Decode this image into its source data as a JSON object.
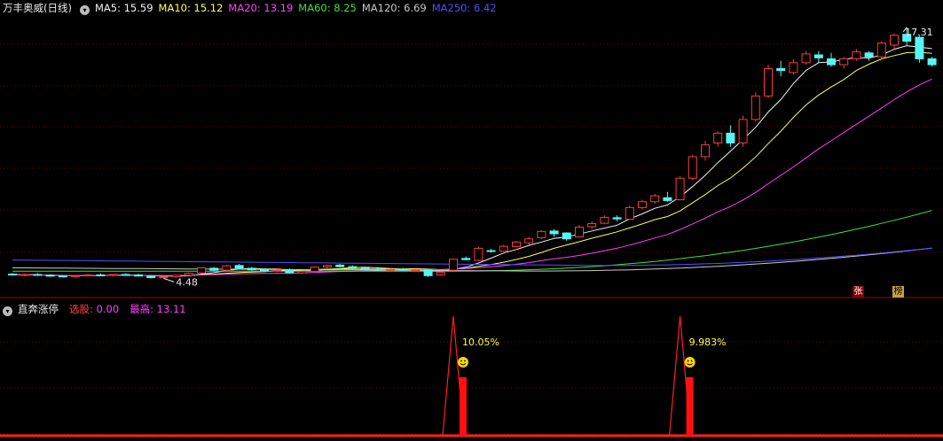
{
  "colors": {
    "up": "#ff3a3a",
    "down": "#56f5f5",
    "ma5": "#f2f2f2",
    "ma10": "#ffff50",
    "ma20": "#ff40ff",
    "ma60": "#40e040",
    "ma120": "#c8c8c8",
    "ma250": "#5050ff",
    "grid": "#7a0000",
    "text_white": "#e8e8e8"
  },
  "header": {
    "title": "万丰奥威(日线)",
    "ma_labels": [
      {
        "name": "MA5",
        "value": "15.59"
      },
      {
        "name": "MA10",
        "value": "15.12"
      },
      {
        "name": "MA20",
        "value": "13.19"
      },
      {
        "name": "MA60",
        "value": "8.25"
      },
      {
        "name": "MA120",
        "value": "6.69"
      },
      {
        "name": "MA250",
        "value": "6.42"
      }
    ]
  },
  "indicator": {
    "name": "直奔涨停",
    "fields": [
      {
        "name": "选股",
        "value": "0.00"
      },
      {
        "name": "最高",
        "value": "13.11"
      }
    ]
  },
  "badges": [
    "张",
    "榜"
  ],
  "chart_data": [
    {
      "type": "candlestick",
      "title": "万丰奥威(日线)",
      "ylim": [
        4.0,
        17.8
      ],
      "annotations": [
        {
          "text": "17.31",
          "at": "high",
          "value": 17.31
        },
        {
          "text": "4.48",
          "at": "low",
          "value": 4.48
        }
      ],
      "candles": [
        [
          4.7,
          4.75,
          4.62,
          4.66
        ],
        [
          4.66,
          4.72,
          4.58,
          4.68
        ],
        [
          4.68,
          4.74,
          4.62,
          4.64
        ],
        [
          4.64,
          4.7,
          4.56,
          4.6
        ],
        [
          4.6,
          4.66,
          4.52,
          4.58
        ],
        [
          4.58,
          4.64,
          4.5,
          4.62
        ],
        [
          4.62,
          4.7,
          4.58,
          4.66
        ],
        [
          4.66,
          4.72,
          4.6,
          4.64
        ],
        [
          4.64,
          4.7,
          4.58,
          4.68
        ],
        [
          4.68,
          4.74,
          4.62,
          4.66
        ],
        [
          4.66,
          4.72,
          4.58,
          4.6
        ],
        [
          4.6,
          4.64,
          4.48,
          4.52
        ],
        [
          4.52,
          4.58,
          4.48,
          4.56
        ],
        [
          4.56,
          4.66,
          4.52,
          4.64
        ],
        [
          4.64,
          4.8,
          4.6,
          4.74
        ],
        [
          4.76,
          5.06,
          4.72,
          5.02
        ],
        [
          5.0,
          5.06,
          4.86,
          4.9
        ],
        [
          4.9,
          5.16,
          4.86,
          5.12
        ],
        [
          5.14,
          5.22,
          4.96,
          5.0
        ],
        [
          5.0,
          5.06,
          4.88,
          4.92
        ],
        [
          4.92,
          4.98,
          4.84,
          4.88
        ],
        [
          4.88,
          4.96,
          4.8,
          4.9
        ],
        [
          4.9,
          4.98,
          4.72,
          4.76
        ],
        [
          4.76,
          4.86,
          4.7,
          4.84
        ],
        [
          4.84,
          5.1,
          4.8,
          5.06
        ],
        [
          5.06,
          5.18,
          5.0,
          5.14
        ],
        [
          5.16,
          5.22,
          5.04,
          5.08
        ],
        [
          5.08,
          5.14,
          4.98,
          5.02
        ],
        [
          5.0,
          5.06,
          4.9,
          4.94
        ],
        [
          4.94,
          5.0,
          4.86,
          4.92
        ],
        [
          4.92,
          4.98,
          4.86,
          4.94
        ],
        [
          4.94,
          5.02,
          4.88,
          4.9
        ],
        [
          4.9,
          4.96,
          4.84,
          4.92
        ],
        [
          4.92,
          4.96,
          4.56,
          4.62
        ],
        [
          4.66,
          4.84,
          4.62,
          4.8
        ],
        [
          4.9,
          5.5,
          4.86,
          5.46
        ],
        [
          5.5,
          5.6,
          5.4,
          5.44
        ],
        [
          5.4,
          6.1,
          5.36,
          6.02
        ],
        [
          5.9,
          6.0,
          5.8,
          5.86
        ],
        [
          5.88,
          6.2,
          5.84,
          6.12
        ],
        [
          6.1,
          6.4,
          6.06,
          6.34
        ],
        [
          6.3,
          6.6,
          6.2,
          6.5
        ],
        [
          6.56,
          6.94,
          6.5,
          6.88
        ],
        [
          6.9,
          7.0,
          6.6,
          6.76
        ],
        [
          6.8,
          6.84,
          6.4,
          6.5
        ],
        [
          6.6,
          7.2,
          6.56,
          7.1
        ],
        [
          7.12,
          7.4,
          7.0,
          7.28
        ],
        [
          7.3,
          7.7,
          7.24,
          7.6
        ],
        [
          7.58,
          7.7,
          7.4,
          7.52
        ],
        [
          7.5,
          8.2,
          7.46,
          8.1
        ],
        [
          8.1,
          8.5,
          8.0,
          8.4
        ],
        [
          8.4,
          8.8,
          8.3,
          8.7
        ],
        [
          8.6,
          8.9,
          8.4,
          8.46
        ],
        [
          8.5,
          9.7,
          8.46,
          9.6
        ],
        [
          9.6,
          10.8,
          9.5,
          10.7
        ],
        [
          10.7,
          11.5,
          10.5,
          11.3
        ],
        [
          11.4,
          12.0,
          11.2,
          11.9
        ],
        [
          11.9,
          12.3,
          11.2,
          11.4
        ],
        [
          11.4,
          12.8,
          11.2,
          12.6
        ],
        [
          12.6,
          14.0,
          12.5,
          13.8
        ],
        [
          13.8,
          15.4,
          13.7,
          15.2
        ],
        [
          15.2,
          15.6,
          14.8,
          15.1
        ],
        [
          15.0,
          15.7,
          14.9,
          15.5
        ],
        [
          15.5,
          16.1,
          15.4,
          15.95
        ],
        [
          15.9,
          16.1,
          15.5,
          15.75
        ],
        [
          15.7,
          16.0,
          15.3,
          15.4
        ],
        [
          15.4,
          15.8,
          15.2,
          15.7
        ],
        [
          15.7,
          16.2,
          15.6,
          16.05
        ],
        [
          16.0,
          16.1,
          15.6,
          15.8
        ],
        [
          15.8,
          16.6,
          15.7,
          16.5
        ],
        [
          16.4,
          17.0,
          16.2,
          16.9
        ],
        [
          16.95,
          17.31,
          16.4,
          16.6
        ],
        [
          16.8,
          16.9,
          15.5,
          15.7
        ],
        [
          15.7,
          15.8,
          15.3,
          15.4
        ]
      ]
    },
    {
      "type": "line",
      "title": "直奔涨停",
      "ylim": [
        0,
        13.11
      ],
      "spikes": [
        {
          "index": 35,
          "value": 13.11,
          "label": "10.05%"
        },
        {
          "index": 53,
          "value": 13.11,
          "label": "9.983%"
        }
      ]
    }
  ]
}
